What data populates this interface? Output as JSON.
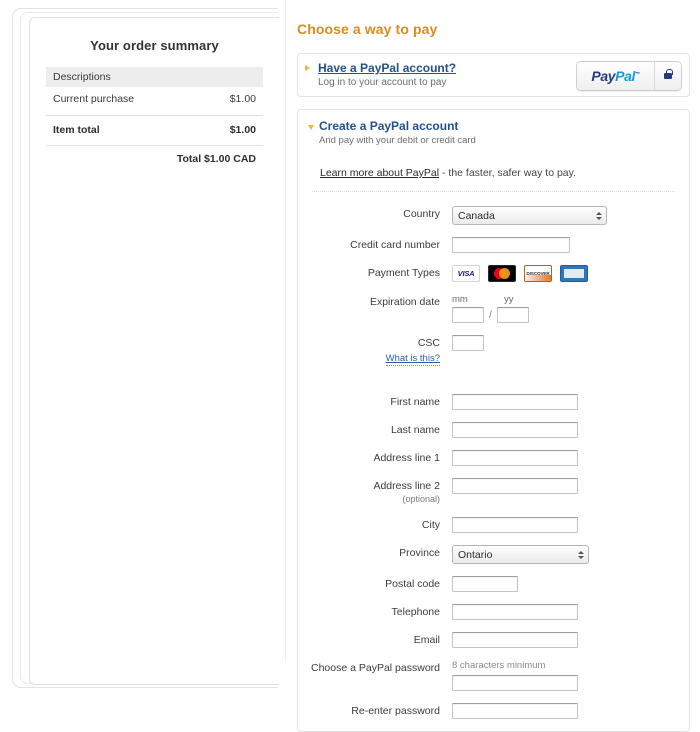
{
  "order_summary": {
    "title": "Your order summary",
    "columns": {
      "description": "Descriptions"
    },
    "rows": [
      {
        "label": "Current purchase",
        "amount": "$1.00"
      }
    ],
    "item_total": {
      "label": "Item total",
      "amount": "$1.00"
    },
    "grand_total": "Total $1.00 CAD"
  },
  "right": {
    "page_title": "Choose a way to pay",
    "have_account": {
      "link": "Have a PayPal account?",
      "subtitle": "Log in to your account to pay",
      "button": {
        "pay": "Pay",
        "pal": "Pal",
        "tm": "™",
        "lock_icon": "lock-icon"
      }
    },
    "create_account": {
      "link": "Create a PayPal account",
      "subtitle": "And pay with your debit or credit card",
      "learn_link": "Learn more about PayPal",
      "learn_rest": " - the faster, safer way to pay."
    },
    "form": {
      "country": {
        "label": "Country",
        "value": "Canada"
      },
      "credit_card": {
        "label": "Credit card number",
        "value": ""
      },
      "payment_types": {
        "label": "Payment Types",
        "cards": [
          {
            "name": "visa-card-icon",
            "text": "VISA"
          },
          {
            "name": "mastercard-card-icon",
            "text": ""
          },
          {
            "name": "discover-card-icon",
            "text": "DISCOVER"
          },
          {
            "name": "amex-card-icon",
            "text": ""
          }
        ]
      },
      "expiration": {
        "label": "Expiration date",
        "mm_label": "mm",
        "yy_label": "yy",
        "mm_value": "",
        "yy_value": "",
        "separator": "/"
      },
      "csc": {
        "label": "CSC",
        "help": "What is this?",
        "value": ""
      },
      "first_name": {
        "label": "First name",
        "value": ""
      },
      "last_name": {
        "label": "Last name",
        "value": ""
      },
      "address1": {
        "label": "Address line 1",
        "value": ""
      },
      "address2": {
        "label": "Address line 2",
        "optional": "(optional)",
        "value": ""
      },
      "city": {
        "label": "City",
        "value": ""
      },
      "province": {
        "label": "Province",
        "value": "Ontario"
      },
      "postal_code": {
        "label": "Postal code",
        "value": ""
      },
      "telephone": {
        "label": "Telephone",
        "value": ""
      },
      "email": {
        "label": "Email",
        "value": ""
      },
      "password": {
        "label": "Choose a PayPal password",
        "hint": "8 characters minimum",
        "value": ""
      },
      "password_confirm": {
        "label": "Re-enter password",
        "value": ""
      }
    }
  }
}
